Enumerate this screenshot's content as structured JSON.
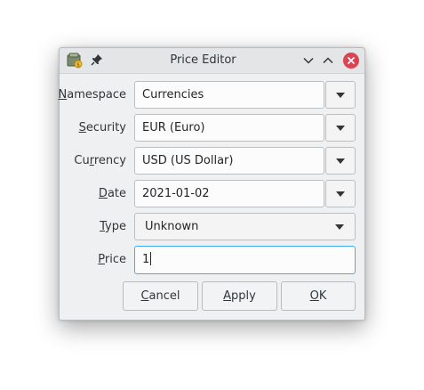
{
  "window": {
    "title": "Price Editor"
  },
  "form": {
    "namespace": {
      "label_pre": "",
      "label_u": "N",
      "label_post": "amespace",
      "value": "Currencies"
    },
    "security": {
      "label_pre": "",
      "label_u": "S",
      "label_post": "ecurity",
      "value": "EUR (Euro)"
    },
    "currency": {
      "label_pre": "Cu",
      "label_u": "r",
      "label_post": "rency",
      "value": "USD (US Dollar)"
    },
    "date": {
      "label_pre": "",
      "label_u": "D",
      "label_post": "ate",
      "value": "2021-01-02"
    },
    "type": {
      "label_pre": "",
      "label_u": "T",
      "label_post": "ype",
      "value": "Unknown"
    },
    "price": {
      "label_pre": "",
      "label_u": "P",
      "label_post": "rice",
      "value": "1"
    }
  },
  "buttons": {
    "cancel": {
      "pre": "",
      "u": "C",
      "post": "ancel"
    },
    "apply": {
      "pre": "",
      "u": "A",
      "post": "pply"
    },
    "ok": {
      "pre": "",
      "u": "O",
      "post": "K"
    }
  },
  "icons": {
    "app": "gnucash-app-icon",
    "pin": "pin-icon",
    "minimize": "chevron-down-icon",
    "maximize": "chevron-up-icon",
    "close": "close-icon"
  },
  "colors": {
    "focus": "#3daee9",
    "close": "#da4453"
  }
}
